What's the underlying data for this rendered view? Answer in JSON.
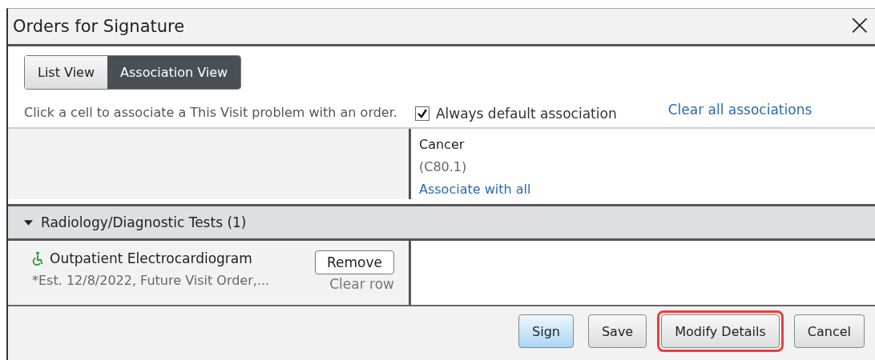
{
  "window": {
    "title": "Orders for Signature",
    "close": "×"
  },
  "view_toggle": [
    {
      "label": "List View",
      "selected": false
    },
    {
      "label": "Association View",
      "selected": true
    }
  ],
  "instruction": "Click a cell to associate a This Visit problem with an order.",
  "default_association": {
    "label": "Always default association",
    "checked": true
  },
  "clear_all_link": "Clear all associations",
  "problems": [
    {
      "name": "Cancer",
      "code": "(C80.1)",
      "link": "Associate with all"
    }
  ],
  "groups": [
    {
      "title": "Radiology/Diagnostic Tests (1)",
      "expanded": true,
      "orders": [
        {
          "name": "Outpatient Electrocardiogram",
          "details": "*Est. 12/8/2022, Future Visit Order,...",
          "remove": "Remove",
          "clear": "Clear row"
        }
      ]
    }
  ],
  "buttons": [
    {
      "label": "Sign",
      "primary": true,
      "highlighted": false
    },
    {
      "label": "Save",
      "primary": false,
      "highlighted": false
    },
    {
      "label": "Modify Details",
      "primary": false,
      "highlighted": true
    },
    {
      "label": "Cancel",
      "primary": false,
      "highlighted": false
    }
  ]
}
